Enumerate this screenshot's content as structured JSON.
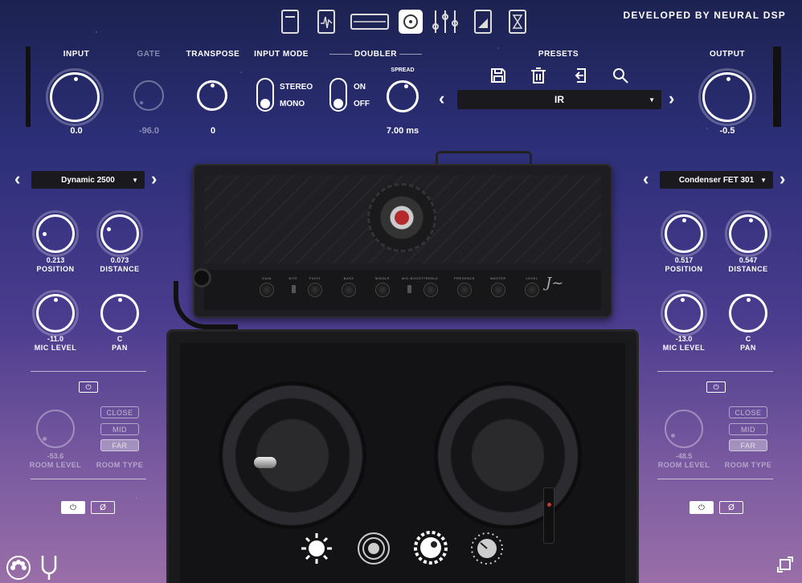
{
  "brand": "DEVELOPED BY NEURAL DSP",
  "top_icons": [
    "amp-head-icon",
    "pedal-icon",
    "rack-icon",
    "cab-icon",
    "eq-sliders-icon",
    "volume-icon",
    "hourglass-icon"
  ],
  "input": {
    "label": "INPUT",
    "value": "0.0"
  },
  "gate": {
    "label": "GATE",
    "value": "-96.0"
  },
  "transpose": {
    "label": "TRANSPOSE",
    "value": "0"
  },
  "input_mode": {
    "label": "INPUT MODE",
    "option_a": "STEREO",
    "option_b": "MONO",
    "selected": "MONO"
  },
  "doubler": {
    "label": "DOUBLER",
    "on": "ON",
    "off": "OFF",
    "spread_label": "SPREAD",
    "spread_value": "7.00 ms"
  },
  "presets": {
    "label": "PRESETS",
    "current": "IR"
  },
  "output": {
    "label": "OUTPUT",
    "value": "-0.5"
  },
  "left_mic": {
    "model": "Dynamic 2500",
    "position": {
      "label": "POSITION",
      "value": "0.213"
    },
    "distance": {
      "label": "DISTANCE",
      "value": "0.073"
    },
    "mic_level": {
      "label": "MIC LEVEL",
      "value": "-11.0"
    },
    "pan": {
      "label": "PAN",
      "value": "C"
    },
    "room_level": {
      "label": "ROOM LEVEL",
      "value": "-53.6"
    },
    "room_type": {
      "label": "ROOM TYPE",
      "options": [
        "CLOSE",
        "MID",
        "FAR"
      ],
      "selected": "FAR"
    }
  },
  "right_mic": {
    "model": "Condenser FET 301",
    "position": {
      "label": "POSITION",
      "value": "0.517"
    },
    "distance": {
      "label": "DISTANCE",
      "value": "0.547"
    },
    "mic_level": {
      "label": "MIC LEVEL",
      "value": "-13.0"
    },
    "pan": {
      "label": "PAN",
      "value": "C"
    },
    "room_level": {
      "label": "ROOM LEVEL",
      "value": "-48.5"
    },
    "room_type": {
      "label": "ROOM TYPE",
      "options": [
        "CLOSE",
        "MID",
        "FAR"
      ],
      "selected": "FAR"
    }
  },
  "amp_controls": [
    "GAIN",
    "BITE",
    "FIGHT",
    "BASS",
    "MIDDLE",
    "MID BOOST",
    "TREBLE",
    "PRESENCE",
    "MASTER",
    "LEVEL"
  ],
  "bottom_icons": [
    "gear-sun-icon",
    "spiral-icon",
    "gear-knob-icon",
    "dial-icon"
  ],
  "colors": {
    "bg_top": "#1c2250",
    "bg_bottom": "#9a6fa8",
    "amp": "#1e1e22"
  }
}
